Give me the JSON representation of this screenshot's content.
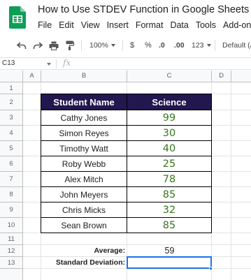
{
  "app": {
    "title": "How to Use STDEV Function in Google Sheets",
    "menu": [
      "File",
      "Edit",
      "View",
      "Insert",
      "Format",
      "Data",
      "Tools",
      "Add-ons"
    ]
  },
  "toolbar": {
    "zoom": "100%",
    "currency": "$",
    "percent": "%",
    "decrease_decimal": ".0",
    "increase_decimal": ".00",
    "number_format": "123",
    "font": "Default (A"
  },
  "formula_bar": {
    "cell_ref": "C13",
    "fx": "fx",
    "content": ""
  },
  "grid": {
    "columns": [
      "A",
      "B",
      "C",
      "D"
    ],
    "rows": [
      "1",
      "2",
      "3",
      "4",
      "5",
      "6",
      "7",
      "8",
      "9",
      "10",
      "11",
      "12",
      "13"
    ]
  },
  "table": {
    "headers": [
      "Student Name",
      "Science"
    ],
    "rows": [
      {
        "name": "Cathy Jones",
        "score": "99"
      },
      {
        "name": "Simon Reyes",
        "score": "30"
      },
      {
        "name": "Timothy Watt",
        "score": "40"
      },
      {
        "name": "Roby Webb",
        "score": "25"
      },
      {
        "name": "Alex Mitch",
        "score": "78"
      },
      {
        "name": "John Meyers",
        "score": "85"
      },
      {
        "name": "Chris Micks",
        "score": "32"
      },
      {
        "name": "Sean Brown",
        "score": "85"
      }
    ]
  },
  "summary": {
    "average_label": "Average:",
    "average_value": "59",
    "stdev_label": "Standard Deviation:",
    "stdev_value": ""
  },
  "colors": {
    "header_bg": "#22174f",
    "score_text": "#38761d",
    "selection": "#1a73e8"
  }
}
